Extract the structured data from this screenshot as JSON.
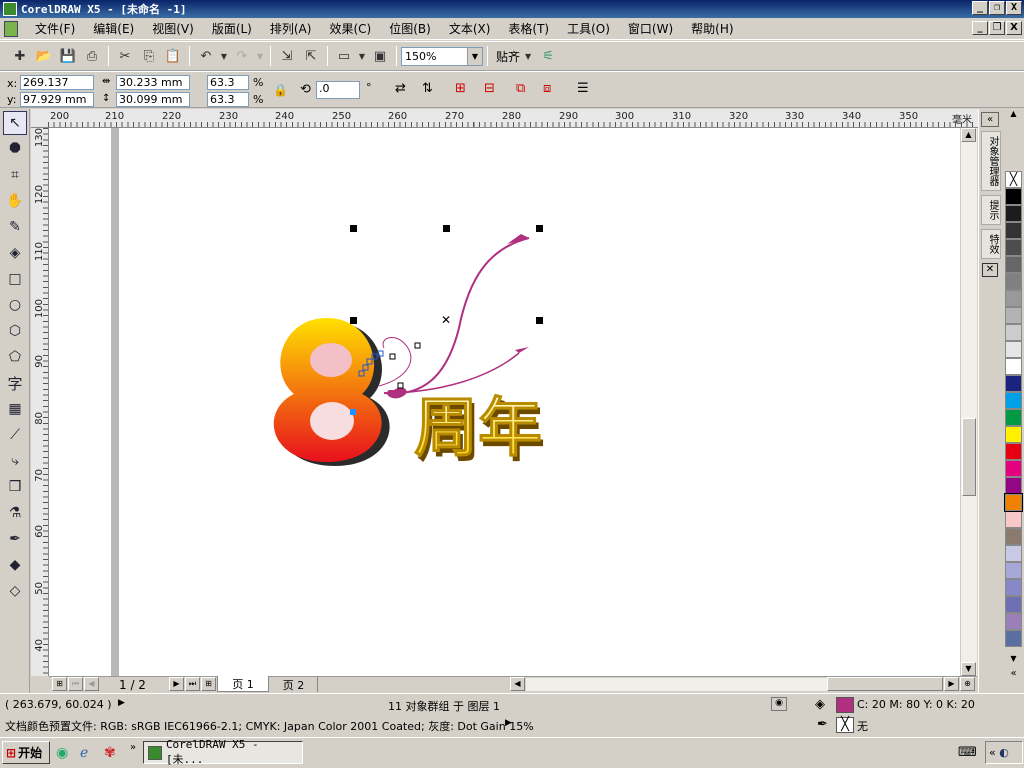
{
  "app": {
    "title": "CorelDRAW X5 - [未命名 -1]"
  },
  "window_controls": {
    "minimize": "_",
    "restore": "❐",
    "close": "X"
  },
  "menu": [
    "文件(F)",
    "编辑(E)",
    "视图(V)",
    "版面(L)",
    "排列(A)",
    "效果(C)",
    "位图(B)",
    "文本(X)",
    "表格(T)",
    "工具(O)",
    "窗口(W)",
    "帮助(H)"
  ],
  "toolbar": {
    "zoom_value": "150%",
    "snap_label": "贴齐"
  },
  "property_bar": {
    "x_label": "x:",
    "y_label": "y:",
    "x_value": "269.137 mm",
    "y_value": "97.929 mm",
    "width_value": "30.233 mm",
    "height_value": "30.099 mm",
    "scale_x": "63.3",
    "scale_y": "63.3",
    "percent": "%",
    "rotation": ".0",
    "degree": "°"
  },
  "ruler": {
    "horizontal": [
      "200",
      "210",
      "220",
      "230",
      "240",
      "250",
      "260",
      "270",
      "280",
      "290",
      "300",
      "310",
      "320",
      "330",
      "340",
      "350"
    ],
    "vertical": [
      "130",
      "120",
      "110",
      "100",
      "90",
      "80",
      "70",
      "60",
      "50",
      "40"
    ],
    "unit": "毫米"
  },
  "artwork": {
    "digit": "8",
    "text": "周年",
    "colors": {
      "digit_top": "#ffe000",
      "digit_bottom": "#e8101c",
      "text_fill": "#ffd400",
      "swirl": "#b03080"
    }
  },
  "page_nav": {
    "page_count": "1 / 2",
    "tabs": [
      "页 1",
      "页 2"
    ]
  },
  "docker_tabs": [
    "对象管理器",
    "提示",
    "特效"
  ],
  "palette": [
    "#ffffff",
    "#000000",
    "#1c1c1c",
    "#333333",
    "#4d4d4d",
    "#666666",
    "#808080",
    "#999999",
    "#b3b3b3",
    "#cccccc",
    "#e6e6e6",
    "#ffffff",
    "#1a237e",
    "#00a0e9",
    "#009944",
    "#fff100",
    "#e60012",
    "#e4007f",
    "#920783",
    "#ef8200",
    "#f8c8c8",
    "#8a7b6e",
    "#c9c9e6",
    "#a8a8d8",
    "#8888c8",
    "#6f6fb4",
    "#9b7fb8",
    "#5a6fa0"
  ],
  "status": {
    "coords": "( 263.679, 60.024 )",
    "selection_info": "11 对象群组 于 图层 1",
    "fill_info": "C: 20 M: 80 Y: 0 K: 20",
    "fill_color": "#b0307f",
    "outline_info": "无",
    "profile": "文档颜色预置文件: RGB: sRGB IEC61966-2.1; CMYK: Japan Color 2001 Coated; 灰度: Dot Gain 15%"
  },
  "taskbar": {
    "start": "开始",
    "task": "CorelDRAW X5 - [未..."
  }
}
